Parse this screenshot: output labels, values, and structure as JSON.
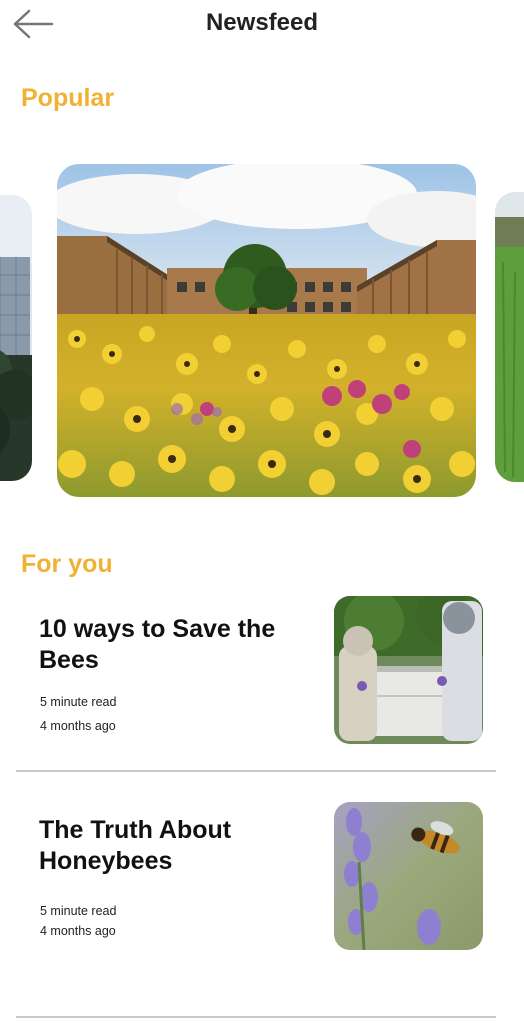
{
  "header": {
    "title": "Newsfeed",
    "back_icon": "arrow-left-icon"
  },
  "sections": {
    "popular": "Popular",
    "for_you": "For you"
  },
  "colors": {
    "accent": "#f0b134",
    "divider": "#c8c8c8"
  },
  "articles": [
    {
      "title": "10 ways to Save the Bees",
      "read_time": "5 minute read",
      "posted": "4 months ago"
    },
    {
      "title": "The Truth About Honeybees",
      "read_time": "5 minute read",
      "posted": "4 months ago"
    }
  ]
}
